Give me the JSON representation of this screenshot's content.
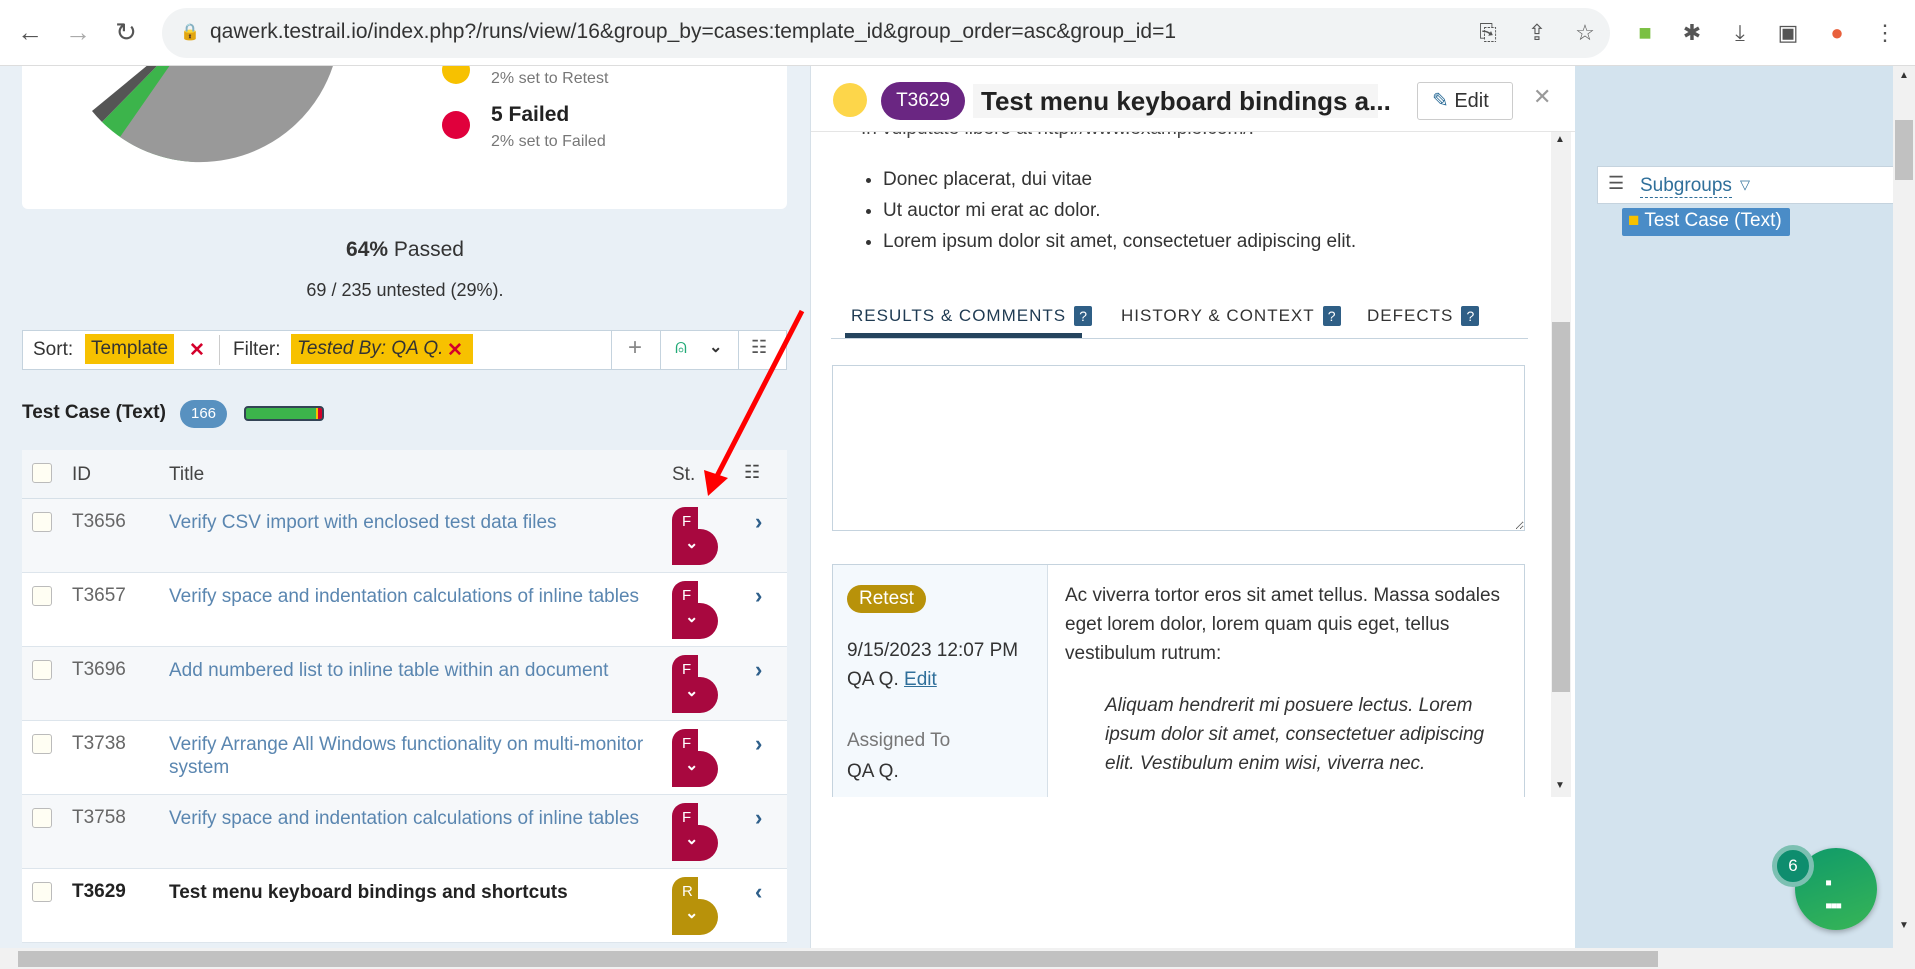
{
  "browser": {
    "url": "qawerk.testrail.io/index.php?/runs/view/16&group_by=cases:template_id&group_order=asc&group_id=1"
  },
  "summary": {
    "legend": [
      {
        "title": "",
        "sub": "2% set to Retest",
        "color": "#f7c100"
      },
      {
        "title": "5 Failed",
        "sub": "2% set to Failed",
        "color": "#e0003c"
      }
    ],
    "passed_pct": "64%",
    "passed_label": "Passed",
    "untested": "69 / 235 untested (29%)."
  },
  "filter": {
    "sort_label": "Sort:",
    "sort_value": "Template",
    "filter_label": "Filter:",
    "filter_value": "Tested By: QA Q."
  },
  "group": {
    "name": "Test Case (Text)",
    "count": "166",
    "progress": {
      "passed": 0.93,
      "failed": 0.03,
      "retest": 0.02
    }
  },
  "table": {
    "headers": {
      "id": "ID",
      "title": "Title",
      "status": "St."
    },
    "rows": [
      {
        "id": "T3656",
        "title": "Verify CSV import with enclosed test data files",
        "status": "F",
        "color": "#a8083f"
      },
      {
        "id": "T3657",
        "title": "Verify space and indentation calculations of inline tables",
        "status": "F",
        "color": "#a8083f"
      },
      {
        "id": "T3696",
        "title": "Add numbered list to inline table within an document",
        "status": "F",
        "color": "#a8083f"
      },
      {
        "id": "T3738",
        "title": "Verify Arrange All Windows functionality on multi-monitor system",
        "status": "F",
        "color": "#a8083f"
      },
      {
        "id": "T3758",
        "title": "Verify space and indentation calculations of inline tables",
        "status": "F",
        "color": "#a8083f"
      },
      {
        "id": "T3629",
        "title": "Test menu keyboard bindings and shortcuts",
        "status": "R",
        "color": "#b8920a"
      }
    ]
  },
  "detail": {
    "id": "T3629",
    "title": "Test menu keyboard bindings a...",
    "edit": "Edit",
    "cut_line": "In vulputate libero at http://www.example.com/.",
    "bullets": [
      "Donec placerat, dui vitae",
      "Ut auctor mi erat ac dolor.",
      "Lorem ipsum dolor sit amet, consectetuer adipiscing elit."
    ],
    "tabs": [
      "RESULTS & COMMENTS",
      "HISTORY & CONTEXT",
      "DEFECTS"
    ],
    "result": {
      "status": "Retest",
      "date": "9/15/2023 12:07 PM",
      "user": "QA Q.",
      "edit": "Edit",
      "assigned_label": "Assigned To",
      "assigned": "QA Q.",
      "comment": "Ac viverra tortor eros sit amet tellus. Massa sodales eget lorem dolor, lorem quam quis eget, tellus vestibulum rutrum:",
      "quote": "Aliquam hendrerit mi posuere lectus. Lorem ipsum dolor sit amet, consectetuer adipiscing elit. Vestibulum enim wisi, viverra nec."
    }
  },
  "sidebar": {
    "subgroups": "Subgroups",
    "item": "Test Case (Text)"
  },
  "fab": {
    "count": "6"
  }
}
